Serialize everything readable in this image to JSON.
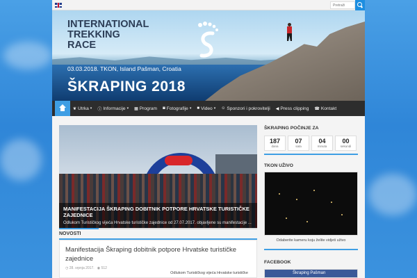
{
  "topbar": {
    "language_icon": "uk-flag-icon",
    "search_placeholder": "Pretraži",
    "search_icon": "search-icon"
  },
  "banner": {
    "title_line1": "INTERNATIONAL",
    "title_line2": "TREKKING",
    "title_line3": "RACE",
    "date_location": "03.03.2018. TKON, Island Pašman, Croatia",
    "event_name": "ŠKRAPING 2018"
  },
  "nav": {
    "items": [
      {
        "icon": "leaf-icon",
        "label": "Utrka",
        "has_dropdown": true
      },
      {
        "icon": "info-icon",
        "label": "Informacije",
        "has_dropdown": true
      },
      {
        "icon": "calendar-icon",
        "label": "Program",
        "has_dropdown": false
      },
      {
        "icon": "camera-icon",
        "label": "Fotografije",
        "has_dropdown": true
      },
      {
        "icon": "video-icon",
        "label": "Video",
        "has_dropdown": true
      },
      {
        "icon": "users-icon",
        "label": "Sponzori i pokrovitelji",
        "has_dropdown": false
      },
      {
        "icon": "megaphone-icon",
        "label": "Press clipping",
        "has_dropdown": false
      },
      {
        "icon": "phone-icon",
        "label": "Kontakt",
        "has_dropdown": false
      }
    ]
  },
  "slider": {
    "title": "MANIFESTACIJA ŠKRAPING DOBITNIK POTPORE HRVATSKE TURISTIČKE ZAJEDNICE",
    "excerpt": "Odlukom Turističkog vijeća Hrvatske turističke zajednice od 27.07.2017. objavljene su manifestacije ...",
    "progress_fraction": 0.2
  },
  "news": {
    "heading": "NOVOSTI",
    "title": "Manifestacija Škraping dobitnik potpore Hrvatske turističke zajednice",
    "date": "28. srpnja 2017.",
    "views": "512",
    "excerpt": "Odlukom Turističkog vijeća Hrvatske turističke"
  },
  "sidebar": {
    "countdown_heading": "ŠKRAPING POČINJE ZA",
    "countdown": [
      {
        "value": "187",
        "label": "dana"
      },
      {
        "value": "07",
        "label": "sata"
      },
      {
        "value": "04",
        "label": "minuta"
      },
      {
        "value": "00",
        "label": "sekundi"
      }
    ],
    "live_heading": "TKON UŽIVO",
    "live_caption": "Odaberite kameru koju želite vidjeti uživo",
    "facebook_heading": "FACEBOOK",
    "facebook_page": "Škraping Pašman"
  },
  "colors": {
    "accent": "#3e9ee4",
    "nav_bg": "#2d2d2d",
    "page_bg": "#2f86d8"
  }
}
